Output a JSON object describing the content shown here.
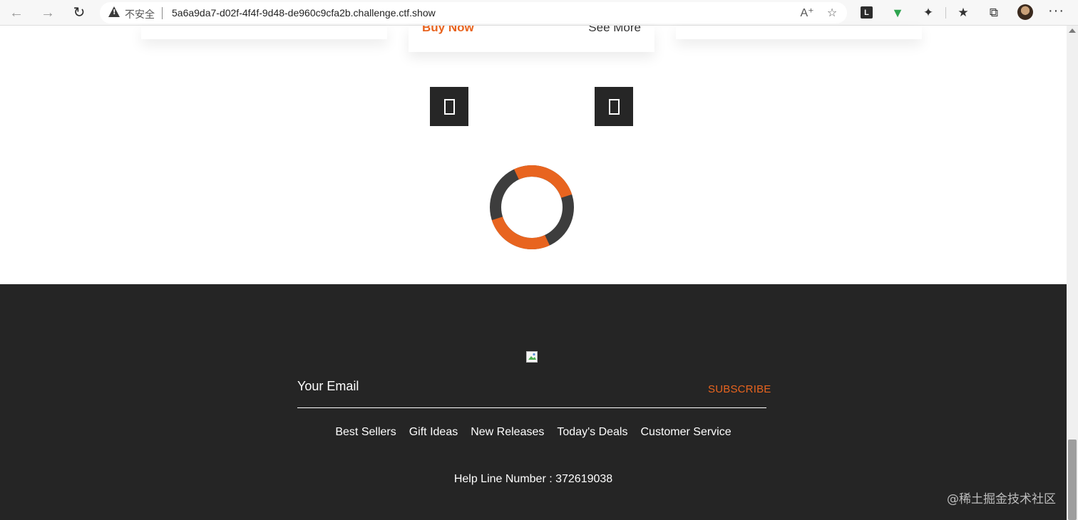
{
  "browser": {
    "security_label": "不安全",
    "url": "5a6a9da7-d02f-4f4f-9d48-de960c9cfa2b.challenge.ctf.show",
    "extension_label": "L"
  },
  "icons": {
    "back": "arrow-left-icon",
    "forward": "arrow-right-icon",
    "reload": "reload-icon",
    "warning": "warning-icon",
    "read_aloud": "read-aloud-icon",
    "favorite": "favorite-star-icon",
    "shield": "shield-icon",
    "extensions": "puzzle-icon",
    "favorites": "favorites-list-icon",
    "collections": "collections-icon",
    "menu": "more-menu-icon",
    "slide_prev": "slider-prev-icon",
    "slide_next": "slider-next-icon"
  },
  "cards": {
    "middle": {
      "buy_label": "Buy Now",
      "more_label": "See More"
    }
  },
  "loader": {
    "colors": [
      "#e8641f",
      "#3d3d3d"
    ]
  },
  "footer": {
    "email_placeholder": "Your Email",
    "subscribe_label": "SUBSCRIBE",
    "links": [
      "Best Sellers",
      "Gift Ideas",
      "New Releases",
      "Today's Deals",
      "Customer Service"
    ],
    "helpline": "Help Line Number : 372619038"
  },
  "watermark": "@稀土掘金技术社区",
  "colors": {
    "accent": "#e8641f",
    "footer_bg": "#252525",
    "button_bg": "#262626"
  }
}
